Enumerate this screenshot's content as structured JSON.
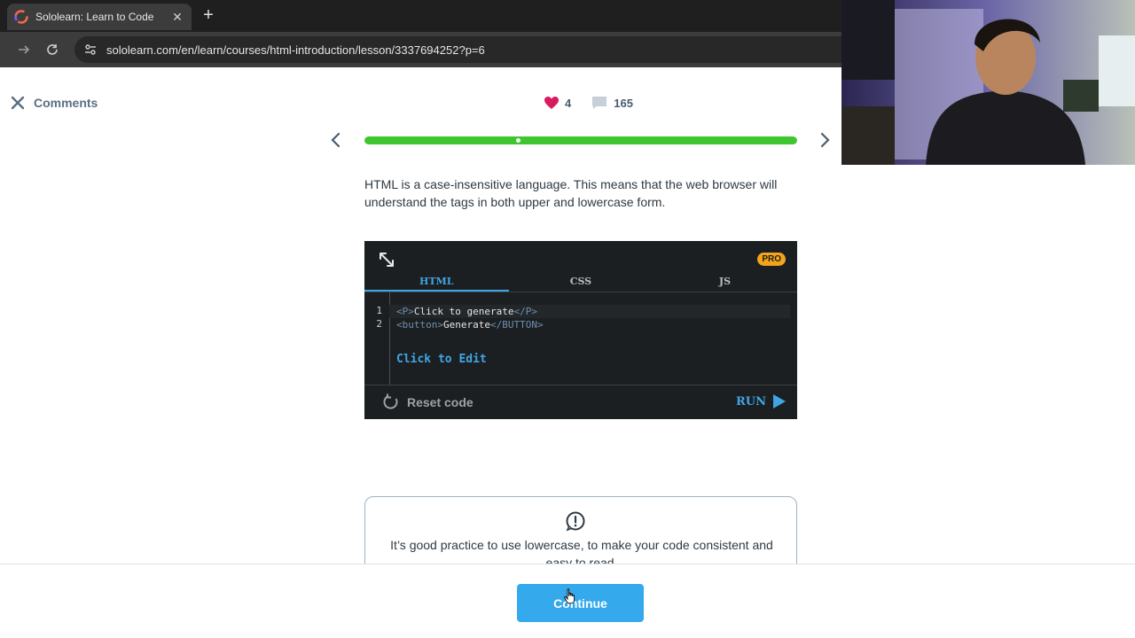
{
  "browser": {
    "tab_title": "Sololearn: Learn to Code",
    "tab_close": "✕",
    "new_tab": "+",
    "url": "sololearn.com/en/learn/courses/html-introduction/lesson/3337694252?p=6"
  },
  "header": {
    "comments_label": "Comments",
    "likes": "4",
    "comments_count": "165"
  },
  "progress": {
    "fraction": 1.0,
    "marker_position": 0.35
  },
  "lesson": {
    "text": "HTML is a case-insensitive language. This means that the web browser will understand the tags in both upper and lowercase form."
  },
  "editor": {
    "pro_badge": "PRO",
    "tabs": [
      "HTML",
      "CSS",
      "JS"
    ],
    "active_tab": "HTML",
    "lines": [
      {
        "no": "1",
        "open_tag": "<P>",
        "text": "Click to generate",
        "close_tag": "</P>"
      },
      {
        "no": "2",
        "open_tag": "<button>",
        "text": "Generate",
        "close_tag": "</BUTTON>"
      }
    ],
    "click_to_edit": "Click to Edit",
    "reset_label": "Reset code",
    "run_label": "RUN"
  },
  "note": {
    "text": "It’s good practice to use lowercase, to make your code consistent and easy to read."
  },
  "footer": {
    "continue_label": "Continue"
  },
  "colors": {
    "accent": "#34a9ec",
    "progress": "#3fc52d",
    "heart": "#d81b60",
    "pro": "#f3a41a",
    "editor_bg": "#1c1f21"
  }
}
